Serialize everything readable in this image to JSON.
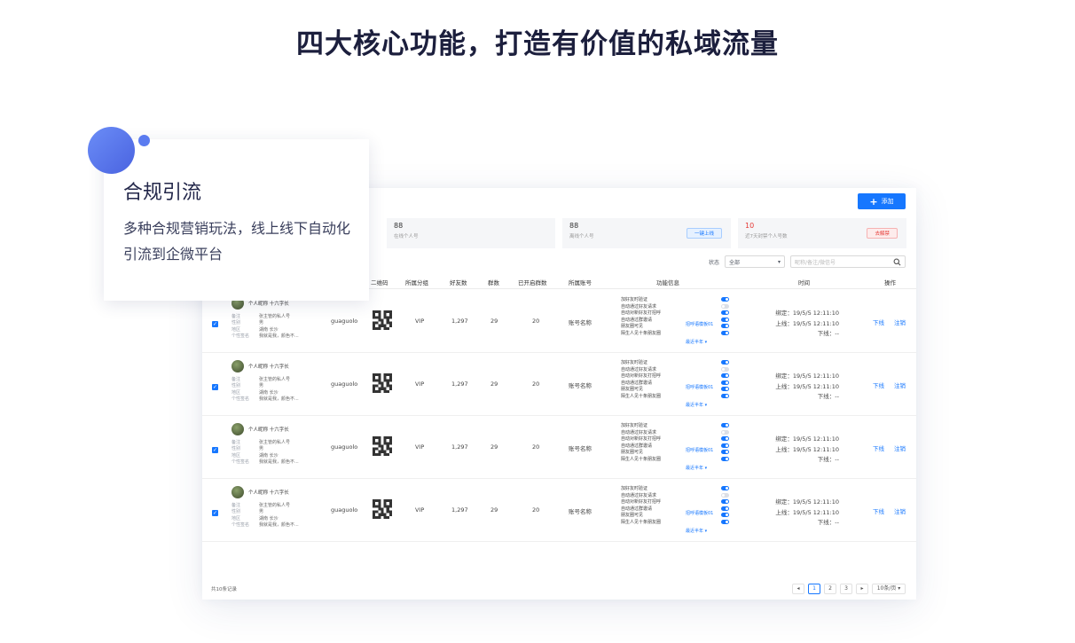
{
  "page": {
    "title": "四大核心功能，打造有价值的私域流量"
  },
  "feature_card": {
    "title": "合规引流",
    "desc": "多种合规营销玩法，线上线下自动化引流到企微平台"
  },
  "mock": {
    "add_button": "添加",
    "stats": [
      {
        "num": "88",
        "label": "在线个人号",
        "pill": ""
      },
      {
        "num": "88",
        "label": "离线个人号",
        "pill": "一键上线"
      },
      {
        "num": "10",
        "label": "近7天封禁个人号数",
        "pill": "去解禁"
      }
    ],
    "filter": {
      "status_label": "状态",
      "status_value": "全部",
      "search_placeholder": "昵称/备注/微信号"
    },
    "headers": [
      "二维码",
      "所属分组",
      "好友数",
      "群数",
      "已开启群数",
      "所属账号",
      "功能信息",
      "时间",
      "操作"
    ],
    "rows": [
      {
        "nickname": "个人昵称 十六字长",
        "info": [
          {
            "k": "备注",
            "v": "张主管的私人号"
          },
          {
            "k": "性别",
            "v": "男"
          },
          {
            "k": "地区",
            "v": "湖南  长沙"
          },
          {
            "k": "个性签名",
            "v": "我就是我，颜色不..."
          }
        ],
        "wechat": "guaguolo",
        "group": "VIP",
        "friends": "1,297",
        "groups": "29",
        "open_groups": "20",
        "account": "账号名称",
        "funcs": [
          "加好友时验证",
          "自动通过好友请求",
          "自动对新好友打招呼",
          "自动通过群邀请",
          "朋友圈可见",
          "陌生人见十条朋友圈"
        ],
        "links": [
          "招呼语模板01",
          "最近半年 ▾"
        ],
        "toggles": [
          "on",
          "off",
          "on",
          "on",
          "on",
          "on"
        ],
        "times": [
          "绑定：19/5/5 12:11:10",
          "上线：19/5/5 12:11:10",
          "下线：--"
        ],
        "ops": [
          "下线",
          "注销"
        ]
      },
      {
        "nickname": "个人昵称 十六字长",
        "info": [
          {
            "k": "备注",
            "v": "张主管的私人号"
          },
          {
            "k": "性别",
            "v": "男"
          },
          {
            "k": "地区",
            "v": "湖南  长沙"
          },
          {
            "k": "个性签名",
            "v": "我就是我，颜色不..."
          }
        ],
        "wechat": "guaguolo",
        "group": "VIP",
        "friends": "1,297",
        "groups": "29",
        "open_groups": "20",
        "account": "账号名称",
        "funcs": [
          "加好友时验证",
          "自动通过好友请求",
          "自动对新好友打招呼",
          "自动通过群邀请",
          "朋友圈可见",
          "陌生人见十条朋友圈"
        ],
        "links": [
          "招呼语模板01",
          "最近半年 ▾"
        ],
        "toggles": [
          "on",
          "off",
          "on",
          "on",
          "on",
          "on"
        ],
        "times": [
          "绑定：19/5/5 12:11:10",
          "上线：19/5/5 12:11:10",
          "下线：--"
        ],
        "ops": [
          "下线",
          "注销"
        ]
      },
      {
        "nickname": "个人昵称 十六字长",
        "info": [
          {
            "k": "备注",
            "v": "张主管的私人号"
          },
          {
            "k": "性别",
            "v": "男"
          },
          {
            "k": "地区",
            "v": "湖南  长沙"
          },
          {
            "k": "个性签名",
            "v": "我就是我，颜色不..."
          }
        ],
        "wechat": "guaguolo",
        "group": "VIP",
        "friends": "1,297",
        "groups": "29",
        "open_groups": "20",
        "account": "账号名称",
        "funcs": [
          "加好友时验证",
          "自动通过好友请求",
          "自动对新好友打招呼",
          "自动通过群邀请",
          "朋友圈可见",
          "陌生人见十条朋友圈"
        ],
        "links": [
          "招呼语模板01",
          "最近半年 ▾"
        ],
        "toggles": [
          "on",
          "off",
          "on",
          "on",
          "on",
          "on"
        ],
        "times": [
          "绑定：19/5/5 12:11:10",
          "上线：19/5/5 12:11:10",
          "下线：--"
        ],
        "ops": [
          "下线",
          "注销"
        ]
      },
      {
        "nickname": "个人昵称 十六字长",
        "info": [
          {
            "k": "备注",
            "v": "张主管的私人号"
          },
          {
            "k": "性别",
            "v": "男"
          },
          {
            "k": "地区",
            "v": "湖南  长沙"
          },
          {
            "k": "个性签名",
            "v": "我就是我，颜色不..."
          }
        ],
        "wechat": "guaguolo",
        "group": "VIP",
        "friends": "1,297",
        "groups": "29",
        "open_groups": "20",
        "account": "账号名称",
        "funcs": [
          "加好友时验证",
          "自动通过好友请求",
          "自动对新好友打招呼",
          "自动通过群邀请",
          "朋友圈可见",
          "陌生人见十条朋友圈"
        ],
        "links": [
          "招呼语模板01",
          "最近半年 ▾"
        ],
        "toggles": [
          "on",
          "off",
          "on",
          "on",
          "on",
          "on"
        ],
        "times": [
          "绑定：19/5/5 12:11:10",
          "上线：19/5/5 12:11:10",
          "下线：--"
        ],
        "ops": [
          "下线",
          "注销"
        ]
      }
    ],
    "footer": {
      "total": "共10条记录",
      "pages": [
        "◂",
        "1",
        "2",
        "3",
        "▸"
      ],
      "active_page": "1",
      "page_size": "10条/页 ▾"
    }
  },
  "colors": {
    "accent": "#1677ff",
    "title": "#1c1f3d",
    "danger": "#e53935",
    "dot": "#5b7cf0"
  }
}
